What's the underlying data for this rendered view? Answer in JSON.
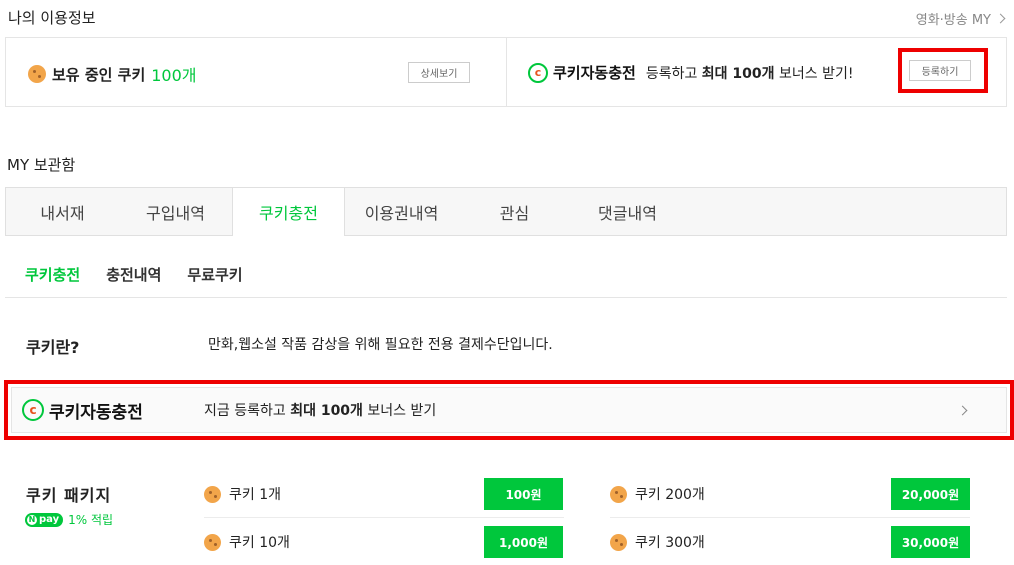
{
  "usage_info": {
    "title": "나의 이용정보",
    "my_link": "영화·방송 MY",
    "owned_prefix": "보유 중인 쿠키",
    "owned_count": "100개",
    "detail_button": "상세보기",
    "auto_charge_logo": "쿠키자동충전",
    "promo_prefix": "등록하고",
    "promo_bold": "최대 100개",
    "promo_suffix": "보너스 받기!",
    "register_button": "등록하기"
  },
  "storage": {
    "title": "MY 보관함",
    "tabs": [
      {
        "label": "내서재"
      },
      {
        "label": "구입내역"
      },
      {
        "label": "쿠키충전"
      },
      {
        "label": "이용권내역"
      },
      {
        "label": "관심"
      },
      {
        "label": "댓글내역"
      }
    ],
    "subtabs": [
      {
        "label": "쿠키충전"
      },
      {
        "label": "충전내역"
      },
      {
        "label": "무료쿠키"
      }
    ]
  },
  "what_is": {
    "label": "쿠키란?",
    "text": "만화,웹소설 작품 감상을 위해 필요한 전용 결제수단입니다."
  },
  "banner": {
    "logo": "쿠키자동충전",
    "text_prefix": "지금 등록하고",
    "text_bold": "최대 100개",
    "text_suffix": "보너스 받기"
  },
  "packages": {
    "title": "쿠키 패키지",
    "npay_label": "pay",
    "npay_text": "1% 적립",
    "items": [
      {
        "name": "쿠키 1개",
        "price": "100원"
      },
      {
        "name": "쿠키 10개",
        "price": "1,000원"
      },
      {
        "name": "쿠키 200개",
        "price": "20,000원"
      },
      {
        "name": "쿠키 300개",
        "price": "30,000원"
      }
    ]
  },
  "colors": {
    "accent_green": "#00c73c",
    "highlight_red": "#ee0000",
    "cookie": "#f2a54a"
  }
}
